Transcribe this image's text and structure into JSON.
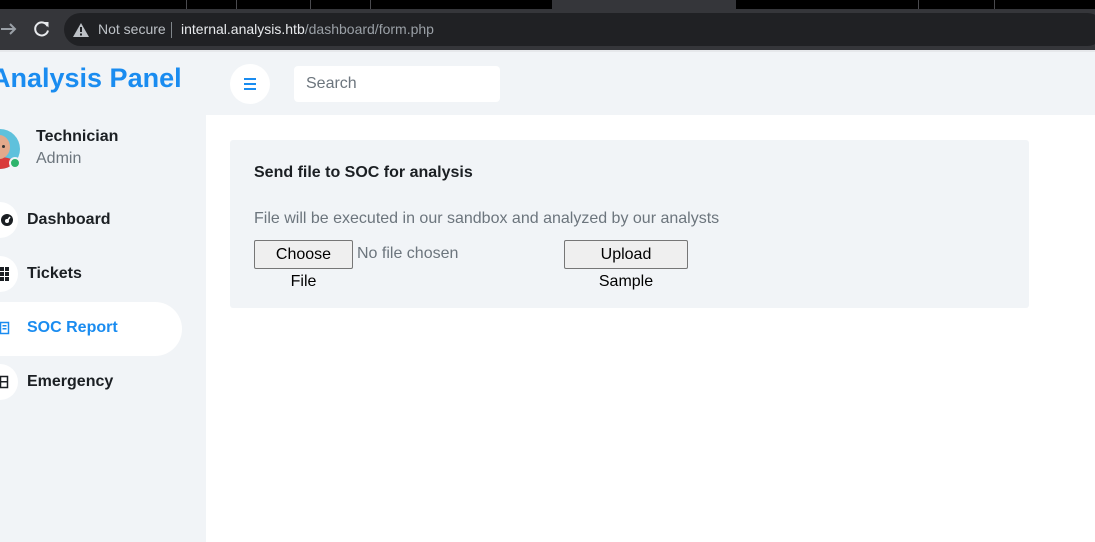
{
  "browser": {
    "security_label": "Not secure",
    "url_host": "internal.analysis.htb",
    "url_path": "/dashboard/form.php"
  },
  "app": {
    "title": "Analysis Panel",
    "accent_color": "#1a8cf0"
  },
  "user": {
    "name": "Technician",
    "role": "Admin",
    "status_color": "#2db36b"
  },
  "sidebar": {
    "items": [
      {
        "label": "Dashboard",
        "icon": "gauge-icon",
        "active": false
      },
      {
        "label": "Tickets",
        "icon": "grid-icon",
        "active": false
      },
      {
        "label": "SOC Report",
        "icon": "table-icon",
        "active": true
      },
      {
        "label": "Emergency",
        "icon": "list-icon",
        "active": false
      }
    ]
  },
  "topbar": {
    "search_placeholder": "Search",
    "menu_icon": "hamburger-icon"
  },
  "form": {
    "title": "Send file to SOC for analysis",
    "description": "File will be executed in our sandbox and analyzed by our analysts",
    "choose_file_label": "Choose File",
    "file_status": "No file chosen",
    "upload_label": "Upload Sample"
  }
}
